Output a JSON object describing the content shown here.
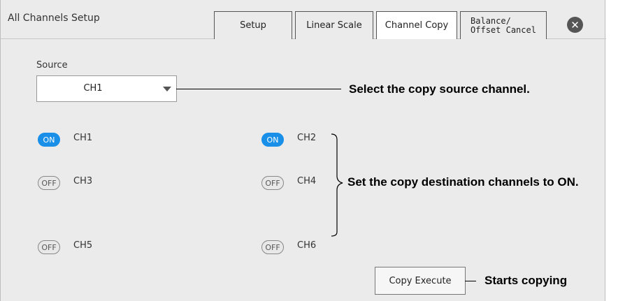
{
  "window": {
    "title": "All Channels Setup"
  },
  "tabs": [
    {
      "label": "Setup"
    },
    {
      "label": "Linear Scale"
    },
    {
      "label": "Channel Copy"
    },
    {
      "label": "Balance/\nOffset Cancel"
    }
  ],
  "source": {
    "label": "Source",
    "value": "CH1"
  },
  "channels": [
    {
      "state": "ON",
      "name": "CH1"
    },
    {
      "state": "ON",
      "name": "CH2"
    },
    {
      "state": "OFF",
      "name": "CH3"
    },
    {
      "state": "OFF",
      "name": "CH4"
    },
    {
      "state": "OFF",
      "name": "CH5"
    },
    {
      "state": "OFF",
      "name": "CH6"
    }
  ],
  "copy_button": {
    "label": "Copy Execute"
  },
  "annotations": {
    "source": "Select the copy source channel.",
    "destination": "Set the copy destination channels to ON.",
    "execute": "Starts copying"
  },
  "colors": {
    "toggle_on": "#1a8fe8",
    "panel_bg": "#ebebeb"
  },
  "icons": {
    "close": "close-icon",
    "dropdown": "chevron-down-icon"
  }
}
